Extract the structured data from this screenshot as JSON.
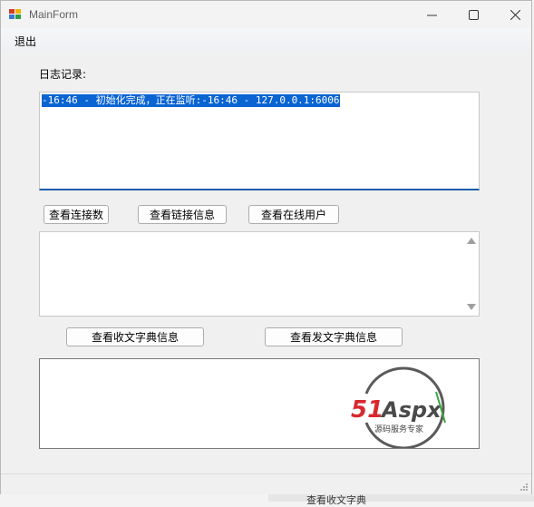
{
  "window": {
    "title": "MainForm"
  },
  "menu": {
    "exit_label": "退出"
  },
  "log": {
    "label": "日志记录:",
    "selected_line": "-16:46 - 初始化完成，正在监听:-16:46 - 127.0.0.1:6006"
  },
  "buttons": {
    "view_connections": "查看连接数",
    "view_link_info": "查看链接信息",
    "view_online_users": "查看在线用户",
    "view_recv_dict": "查看收文字典信息",
    "view_send_dict": "查看发文字典信息"
  },
  "logo": {
    "brand": "51Aspx",
    "tagline": "源码服务专家"
  },
  "background": {
    "partial_text": "查看收文字典"
  },
  "colors": {
    "selection": "#0a64d2",
    "focus_underline": "#1c5fa8",
    "logo_red": "#d8282e",
    "logo_gray": "#5a5a5a",
    "logo_green": "#3aa842"
  }
}
